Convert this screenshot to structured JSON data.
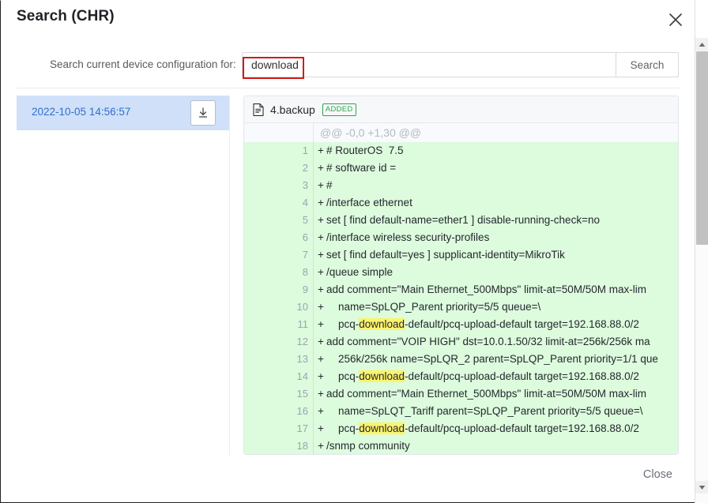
{
  "dialog": {
    "title": "Search (CHR)",
    "close_icon": "close-icon"
  },
  "search": {
    "label": "Search current device configuration for:",
    "value": "download",
    "placeholder": "",
    "button_label": "Search",
    "annotation_color": "#d21b1b"
  },
  "sidebar": {
    "items": [
      {
        "timestamp": "2022-10-05 14:56:57",
        "download_icon": "download-icon",
        "selected": true
      }
    ]
  },
  "diff": {
    "file_icon": "file-document-icon",
    "file_name": "4.backup",
    "status_badge": "ADDED",
    "hunk_header": "@@ -0,0 +1,30 @@",
    "highlight_term": "download",
    "highlight_color": "#fbf36b",
    "added_bg": "#ddfbdd",
    "lines": [
      {
        "num": "1",
        "marker": "+",
        "text": "# RouterOS  7.5"
      },
      {
        "num": "2",
        "marker": "+",
        "text": "# software id ="
      },
      {
        "num": "3",
        "marker": "+",
        "text": "#"
      },
      {
        "num": "4",
        "marker": "+",
        "text": "/interface ethernet"
      },
      {
        "num": "5",
        "marker": "+",
        "text": "set [ find default-name=ether1 ] disable-running-check=no"
      },
      {
        "num": "6",
        "marker": "+",
        "text": "/interface wireless security-profiles"
      },
      {
        "num": "7",
        "marker": "+",
        "text": "set [ find default=yes ] supplicant-identity=MikroTik"
      },
      {
        "num": "8",
        "marker": "+",
        "text": "/queue simple"
      },
      {
        "num": "9",
        "marker": "+",
        "text": "add comment=\"Main Ethernet_500Mbps\" limit-at=50M/50M max-lim"
      },
      {
        "num": "10",
        "marker": "+",
        "text": "    name=SpLQP_Parent priority=5/5 queue=\\"
      },
      {
        "num": "11",
        "marker": "+",
        "text": "    pcq-download-default/pcq-upload-default target=192.168.88.0/2"
      },
      {
        "num": "12",
        "marker": "+",
        "text": "add comment=\"VOIP HIGH\" dst=10.0.1.50/32 limit-at=256k/256k ma"
      },
      {
        "num": "13",
        "marker": "+",
        "text": "    256k/256k name=SpLQR_2 parent=SpLQP_Parent priority=1/1 que"
      },
      {
        "num": "14",
        "marker": "+",
        "text": "    pcq-download-default/pcq-upload-default target=192.168.88.0/2"
      },
      {
        "num": "15",
        "marker": "+",
        "text": "add comment=\"Main Ethernet_500Mbps\" limit-at=50M/50M max-lim"
      },
      {
        "num": "16",
        "marker": "+",
        "text": "    name=SpLQT_Tariff parent=SpLQP_Parent priority=5/5 queue=\\"
      },
      {
        "num": "17",
        "marker": "+",
        "text": "    pcq-download-default/pcq-upload-default target=192.168.88.0/2"
      },
      {
        "num": "18",
        "marker": "+",
        "text": "/snmp community"
      }
    ]
  },
  "footer": {
    "close_label": "Close"
  }
}
